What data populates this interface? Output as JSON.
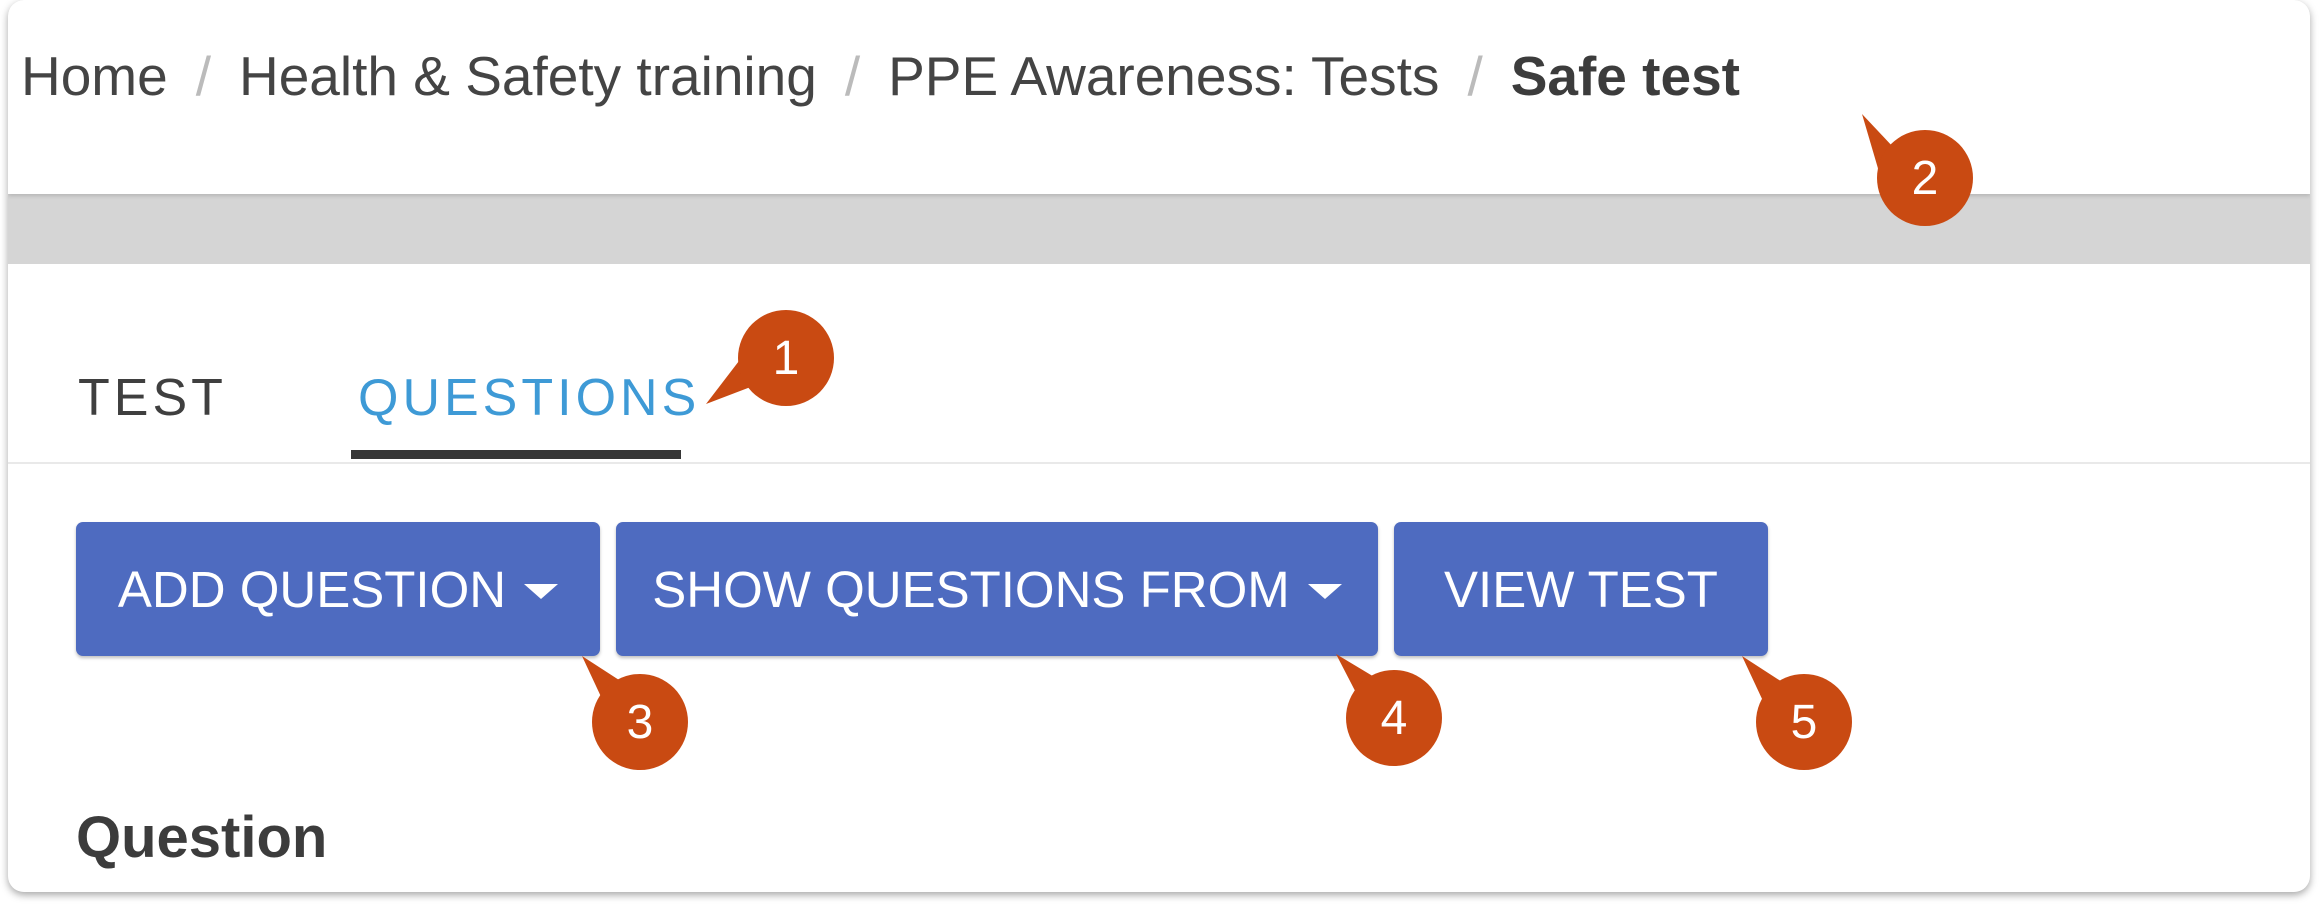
{
  "breadcrumb": {
    "items": [
      "Home",
      "Health & Safety training",
      "PPE Awareness: Tests"
    ],
    "separator": "/",
    "current": "Safe test"
  },
  "tabs": [
    {
      "label": "TEST",
      "active": false
    },
    {
      "label": "QUESTIONS",
      "active": true
    }
  ],
  "toolbar": {
    "add_question_label": "ADD QUESTION",
    "show_questions_from_label": "SHOW QUESTIONS FROM",
    "view_test_label": "VIEW TEST"
  },
  "section": {
    "heading": "Question"
  },
  "callouts": [
    "1",
    "2",
    "3",
    "4",
    "5"
  ],
  "colors": {
    "button": "#4e6bc0",
    "tab_active": "#3e9ad6",
    "callout": "#c94a12",
    "backdrop": "#d5d5d5"
  },
  "icons": [
    "caret-down-icon"
  ]
}
